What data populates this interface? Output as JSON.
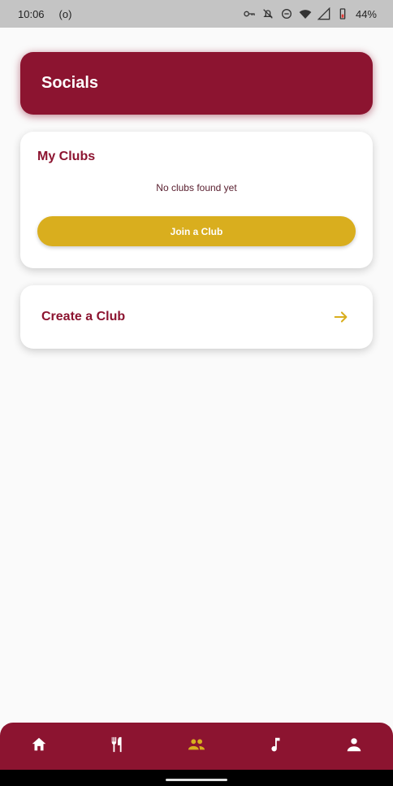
{
  "status_bar": {
    "time": "10:06",
    "extra": "(o)",
    "battery": "44%",
    "icons": [
      "key-icon",
      "bell-off-icon",
      "do-not-disturb-icon",
      "wifi-icon",
      "signal-icon",
      "battery-icon"
    ]
  },
  "header": {
    "title": "Socials"
  },
  "my_clubs": {
    "title": "My Clubs",
    "empty_text": "No clubs found yet",
    "join_label": "Join a Club"
  },
  "create_club": {
    "label": "Create a Club",
    "icon": "arrow-right-icon"
  },
  "bottom_nav": {
    "items": [
      {
        "icon": "home-icon",
        "active": false
      },
      {
        "icon": "restaurant-icon",
        "active": false
      },
      {
        "icon": "people-icon",
        "active": true
      },
      {
        "icon": "music-note-icon",
        "active": false
      },
      {
        "icon": "person-icon",
        "active": false
      }
    ]
  },
  "colors": {
    "primary": "#8c1430",
    "accent": "#d9ae1e",
    "background": "#fafafa"
  }
}
